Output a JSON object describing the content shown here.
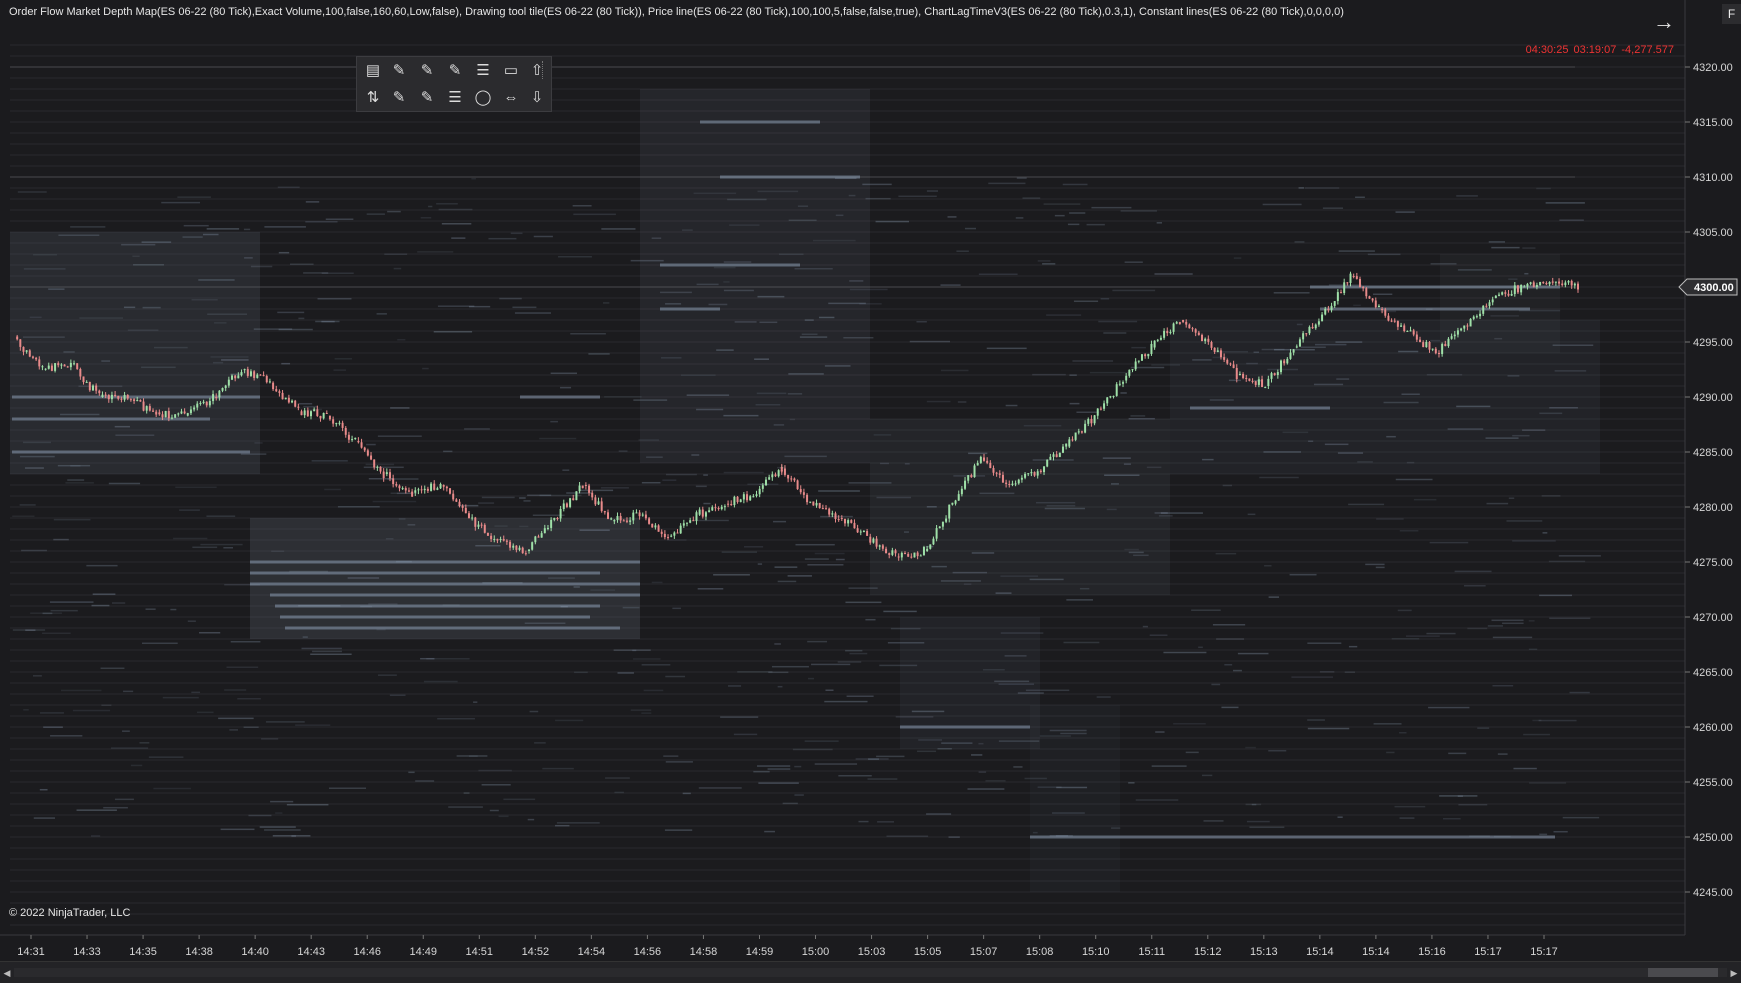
{
  "header": {
    "indicator_text": "Order Flow Market Depth Map(ES 06-22 (80 Tick),Exact Volume,100,false,160,60,Low,false), Drawing tool tile(ES 06-22 (80 Tick)), Price line(ES 06-22 (80 Tick),100,100,5,false,false,true), ChartLagTimeV3(ES 06-22 (80 Tick),0.3,1), Constant lines(ES 06-22 (80 Tick),0,0,0,0)",
    "timer_text": "04:30:25   03:19:07   -4,277.577",
    "f_label": "F",
    "arrow_icon": "arrow-right-icon"
  },
  "copyright": "© 2022 NinjaTrader, LLC",
  "current_price": "4300.00",
  "colors": {
    "background": "#1b1b1e",
    "up": "#9fe0a8",
    "down": "#e88a8a",
    "timer": "#e33333",
    "depth": "#8a9bb0"
  },
  "toolbar": {
    "rows": [
      [
        "ruler-icon",
        "line-icon",
        "ray-icon",
        "extended-line-icon",
        "fibonacci-icon",
        "rectangle-icon",
        "arrow-up-icon"
      ],
      [
        "buy-sell-icon",
        "trend-channel-icon",
        "andrews-icon",
        "horizontal-lines-icon",
        "ellipse-icon",
        "arrow-left-right-icon",
        "arrow-down-icon"
      ]
    ]
  },
  "axis": {
    "price_min": 4242,
    "price_max": 4322,
    "price_ticks": [
      "4320.00",
      "4315.00",
      "4310.00",
      "4305.00",
      "4300.00",
      "4295.00",
      "4290.00",
      "4285.00",
      "4280.00",
      "4275.00",
      "4270.00",
      "4265.00",
      "4260.00",
      "4255.00",
      "4250.00",
      "4245.00"
    ],
    "time_ticks": [
      "14:31",
      "14:33",
      "14:35",
      "14:38",
      "14:40",
      "14:43",
      "14:46",
      "14:49",
      "14:51",
      "14:52",
      "14:54",
      "14:56",
      "14:58",
      "14:59",
      "15:00",
      "15:03",
      "15:05",
      "15:07",
      "15:08",
      "15:10",
      "15:11",
      "15:12",
      "15:13",
      "15:14",
      "15:14",
      "15:16",
      "15:17",
      "15:17"
    ]
  },
  "chart_data": {
    "type": "line",
    "series": [
      {
        "x": [
          0,
          1,
          2,
          3,
          4,
          5,
          6,
          7,
          8,
          9,
          10,
          11,
          12,
          13,
          14,
          15,
          16,
          17,
          18,
          19,
          20,
          21,
          22,
          23,
          24,
          25,
          26,
          27
        ],
        "values": [
          4295.5,
          4292.5,
          4293.0,
          4290.0,
          4289.8,
          4288.6,
          4288.3,
          4290.0,
          4292.5,
          4291.3,
          4288.7,
          4288.3,
          4286.0,
          4283.0,
          4281.3,
          4282.0,
          4279.0,
          4277.0,
          4276.0,
          4279.0,
          4282.0,
          4278.7,
          4279.3,
          4277.3,
          4279.3,
          4280.3,
          4281.0,
          4283.5
        ]
      },
      {
        "x": [
          27,
          28,
          29,
          30,
          31,
          32,
          33,
          34,
          35,
          36,
          37,
          38,
          39,
          40,
          41,
          42,
          43,
          44,
          45,
          46,
          47,
          48,
          49,
          50,
          51,
          52,
          53,
          54,
          55
        ],
        "values": [
          4283.5,
          4280.5,
          4279.0,
          4277.3,
          4275.5,
          4276.0,
          4280.3,
          4284.5,
          4282.0,
          4283.3,
          4285.5,
          4288.3,
          4291.5,
          4294.5,
          4297.0,
          4295.0,
          4292.0,
          4291.0,
          4294.5,
          4297.5,
          4301.0,
          4298.0,
          4296.0,
          4294.0,
          4296.5,
          4299.0,
          4300.0,
          4300.5,
          4300.0
        ]
      }
    ]
  }
}
